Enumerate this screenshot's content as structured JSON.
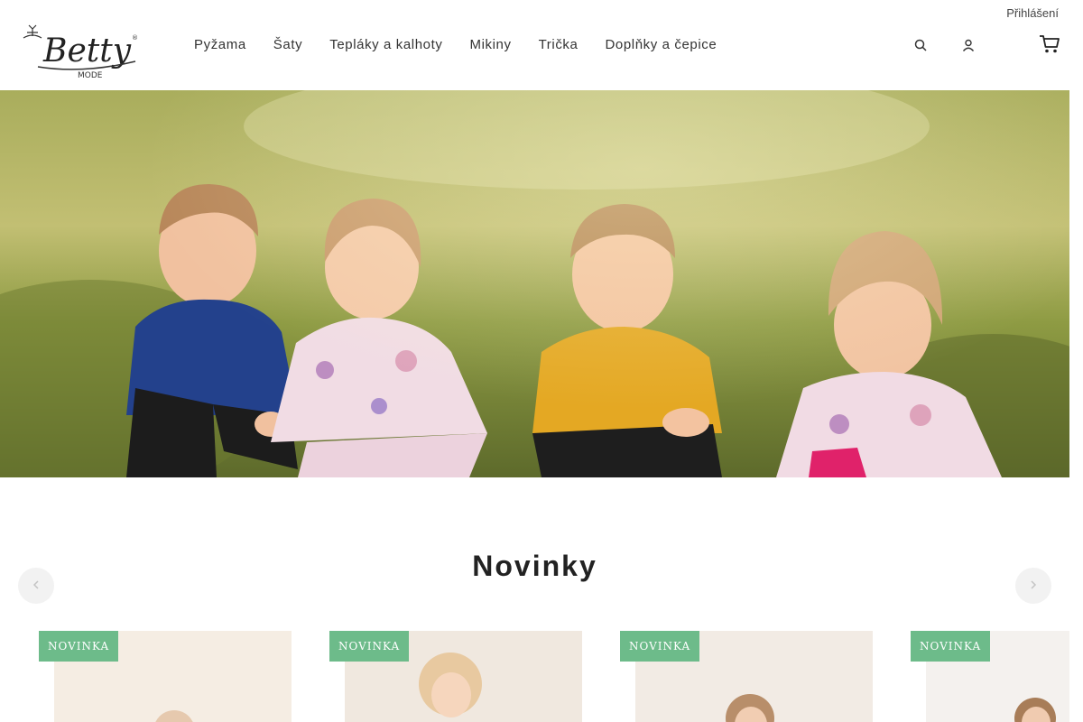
{
  "header": {
    "login_label": "Přihlášení",
    "logo_text": "Betty",
    "logo_subtext": "MODE",
    "nav": [
      "Pyžama",
      "Šaty",
      "Tepláky a kalhoty",
      "Mikiny",
      "Trička",
      "Doplňky a čepice"
    ],
    "icons": {
      "search": "search-icon",
      "account": "user-icon",
      "cart": "cart-icon"
    }
  },
  "hero": {
    "alt": "Děti sedící v trávě"
  },
  "section": {
    "title": "Novinky"
  },
  "carousel": {
    "prev_icon": "chevron-left-icon",
    "next_icon": "chevron-right-icon"
  },
  "products": [
    {
      "badge": "NOVINKA"
    },
    {
      "badge": "NOVINKA"
    },
    {
      "badge": "NOVINKA"
    },
    {
      "badge": "NOVINKA"
    }
  ],
  "colors": {
    "badge": "#6dbb8a",
    "text": "#333333"
  }
}
